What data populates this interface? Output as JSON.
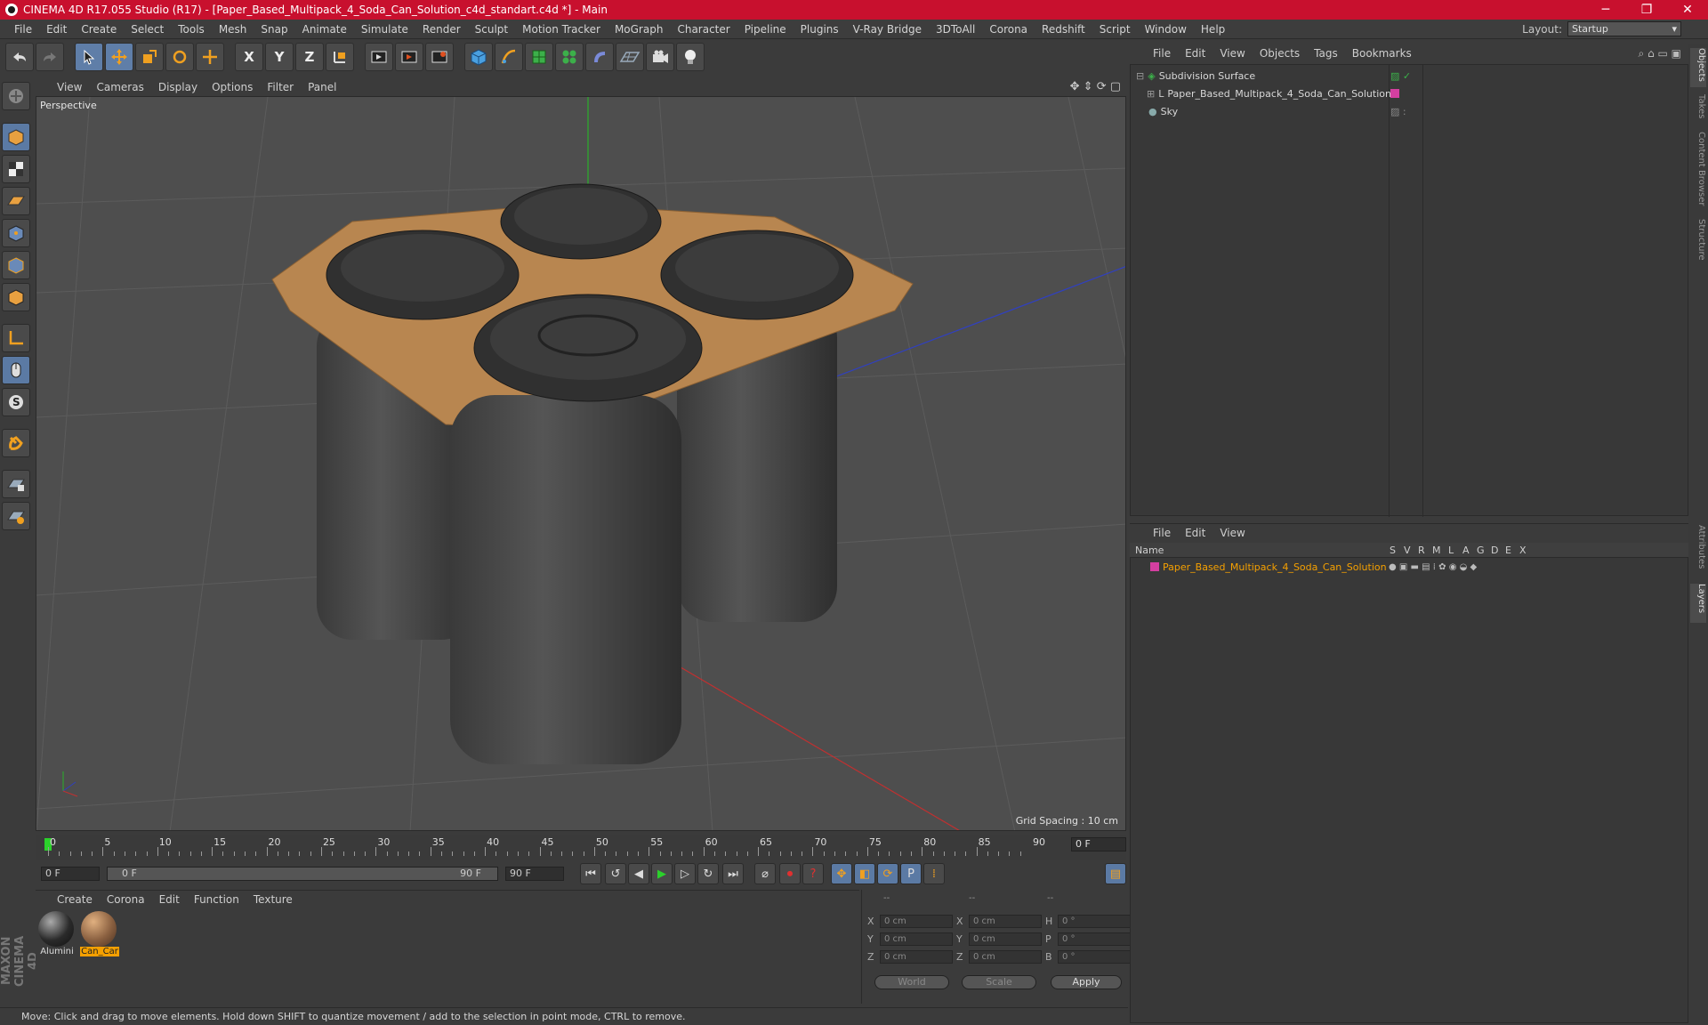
{
  "window": {
    "title": "CINEMA 4D R17.055 Studio (R17) - [Paper_Based_Multipack_4_Soda_Can_Solution_c4d_standart.c4d *] - Main",
    "controls": [
      "─",
      "❐",
      "✕"
    ]
  },
  "menubar": {
    "items": [
      "File",
      "Edit",
      "Create",
      "Select",
      "Tools",
      "Mesh",
      "Snap",
      "Animate",
      "Simulate",
      "Render",
      "Sculpt",
      "Motion Tracker",
      "MoGraph",
      "Character",
      "Pipeline",
      "Plugins",
      "V-Ray Bridge",
      "3DToAll",
      "Corona",
      "Redshift",
      "Script",
      "Window",
      "Help"
    ],
    "layout_label": "Layout:",
    "layout_value": "Startup"
  },
  "toolbar": {
    "icons": [
      "undo-icon",
      "redo-icon",
      "select-icon",
      "move-icon",
      "scale-icon",
      "rotate-icon",
      "live-select-icon",
      "x-axis-icon",
      "y-axis-icon",
      "z-axis-icon",
      "coordinate-system-icon",
      "render-view-icon",
      "render-picture-viewer-icon",
      "edit-render-settings-icon",
      "cube-icon",
      "pen-icon",
      "subdivision-icon",
      "cloner-icon",
      "deformer-icon",
      "floor-icon",
      "camera-icon",
      "light-icon"
    ],
    "axis_labels": [
      "X",
      "Y",
      "Z"
    ]
  },
  "viewport": {
    "menu": [
      "View",
      "Cameras",
      "Display",
      "Options",
      "Filter",
      "Panel"
    ],
    "label": "Perspective",
    "grid_spacing": "Grid Spacing : 10 cm"
  },
  "timeline": {
    "ticks": [
      "0",
      "5",
      "10",
      "15",
      "20",
      "25",
      "30",
      "35",
      "40",
      "45",
      "50",
      "55",
      "60",
      "65",
      "70",
      "75",
      "80",
      "85",
      "90"
    ],
    "current_frame": "0 F",
    "start_field": "0 F",
    "slider_start": "0 F",
    "slider_end": "90 F",
    "end_field": "90 F"
  },
  "materials": {
    "menu": [
      "Create",
      "Corona",
      "Edit",
      "Function",
      "Texture"
    ],
    "items": [
      {
        "label": "Alumini",
        "color": "#2a2a2a"
      },
      {
        "label": "Can_Car",
        "color": "#8a6040"
      }
    ]
  },
  "coordinates": {
    "headers": [
      "--",
      "--",
      "--"
    ],
    "rows": [
      {
        "a": "X",
        "av": "0 cm",
        "b": "X",
        "bv": "0 cm",
        "c": "H",
        "cv": "0 °"
      },
      {
        "a": "Y",
        "av": "0 cm",
        "b": "Y",
        "bv": "0 cm",
        "c": "P",
        "cv": "0 °"
      },
      {
        "a": "Z",
        "av": "0 cm",
        "b": "Z",
        "bv": "0 cm",
        "c": "B",
        "cv": "0 °"
      }
    ],
    "mode1": "World",
    "mode2": "Scale",
    "apply": "Apply"
  },
  "statusbar": {
    "text": "Move: Click and drag to move elements. Hold down SHIFT to quantize movement / add to the selection in point mode, CTRL to remove."
  },
  "objects": {
    "menu": [
      "File",
      "Edit",
      "View",
      "Objects",
      "Tags",
      "Bookmarks"
    ],
    "items": [
      {
        "name": "Subdivision Surface",
        "tag_color": "#39a639"
      },
      {
        "name": "Paper_Based_Multipack_4_Soda_Can_Solution",
        "tag_color": "#d43fa0"
      },
      {
        "name": "Sky",
        "tag_color": ""
      }
    ]
  },
  "layers": {
    "menu": [
      "File",
      "Edit",
      "View"
    ],
    "columns": [
      "Name",
      "S",
      "V",
      "R",
      "M",
      "L",
      "A",
      "G",
      "D",
      "E",
      "X"
    ],
    "items": [
      {
        "name": "Paper_Based_Multipack_4_Soda_Can_Solution",
        "color": "#d43fa0"
      }
    ]
  },
  "side_tabs": [
    "Objects",
    "Takes",
    "Content Browser",
    "Structure",
    "Attributes",
    "Layers"
  ],
  "branding": "MAXON CINEMA 4D"
}
